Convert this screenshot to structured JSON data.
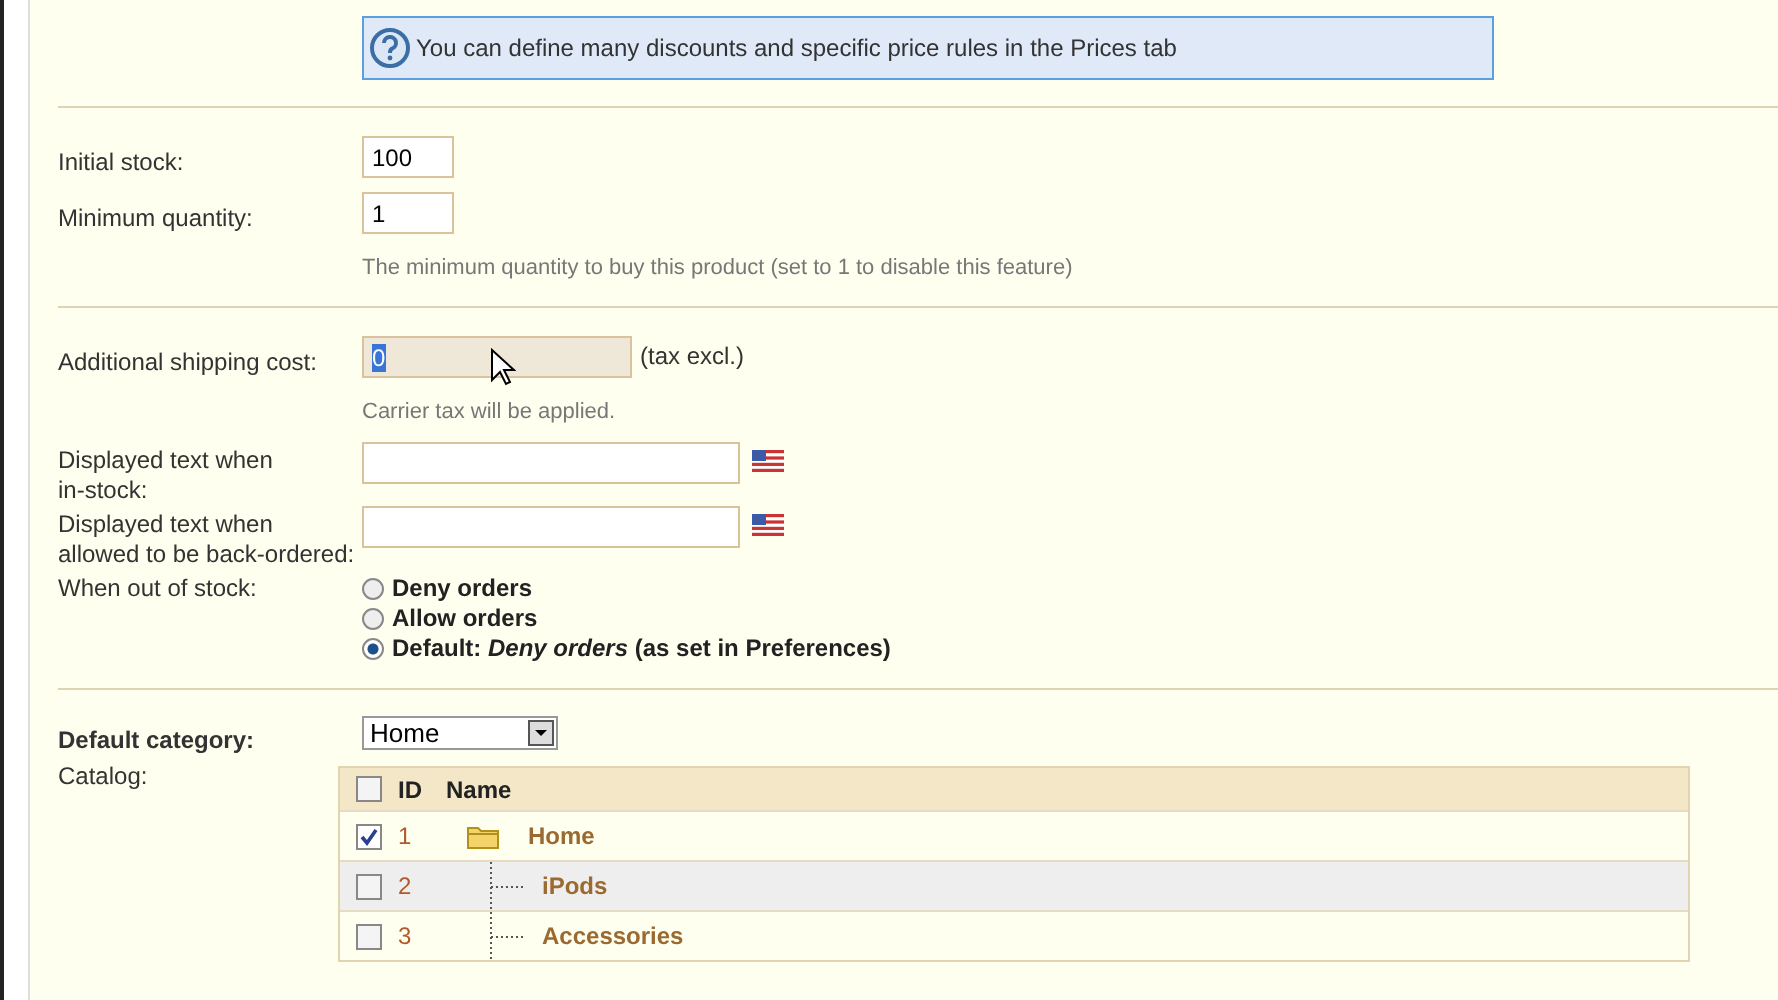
{
  "info_box": {
    "text": "You can define many discounts and specific price rules in the Prices tab"
  },
  "stock_fields": [
    {
      "label": "Initial stock:",
      "value": "100"
    },
    {
      "label": "Minimum quantity:",
      "value": "1"
    }
  ],
  "minimum_hint": "The minimum quantity to buy this product (set to 1 to disable this feature)",
  "shipping": {
    "label": "Additional shipping cost:",
    "value": "0",
    "value_selected": true,
    "suffix": "(tax excl.)",
    "hint": "Carrier tax will be applied."
  },
  "availability_texts": [
    {
      "label": "Displayed text when\nin-stock:"
    },
    {
      "label": "Displayed text when\nallowed to be back-ordered:"
    }
  ],
  "out_of_stock": {
    "label": "When out of stock:",
    "options": [
      {
        "label": "Deny orders",
        "selected": false
      },
      {
        "label": "Allow orders",
        "selected": false
      },
      {
        "label": "Default: *Deny orders* (as set in Preferences)",
        "selected": true
      }
    ]
  },
  "default_category": {
    "label": "Default category:",
    "value": "Home"
  },
  "catalog": {
    "label": "Catalog:",
    "columns": [
      "ID",
      "Name"
    ],
    "all_checked": false,
    "rows": [
      {
        "id": "1",
        "name": "Home",
        "checked": true,
        "kind": "root"
      },
      {
        "id": "2",
        "name": "iPods",
        "checked": false,
        "kind": "child"
      },
      {
        "id": "3",
        "name": "Accessories",
        "checked": false,
        "kind": "child"
      }
    ]
  }
}
